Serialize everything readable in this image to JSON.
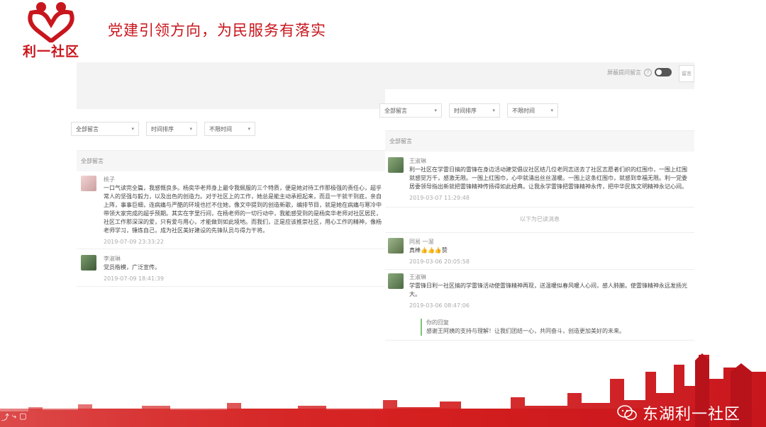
{
  "slide": {
    "logo_text": "利一社区",
    "title": "党建引领方向，为民服务有落实"
  },
  "right_top": {
    "toggle_label": "屏蔽提问留言",
    "button_label": "留言"
  },
  "left_panel": {
    "filters": [
      "全部留言",
      "时间排序",
      "不限时间"
    ],
    "section_title": "全部留言",
    "messages": [
      {
        "name": "桃子",
        "content": "一口气读完全篇，我感慨良多。杨奕华老师身上最令我佩服的三个特质，便是她对待工作那极强的责任心，超乎常人的坚强与毅力，以及出色的创造力。对于社区上的工作，她总是能主动承担起来，而且一干就干到底，亲自上阵，事事巨细，连病痛与严酷的环境也拦不住她，像文中提到的创造新歌，编排节目，就是她在病痛与寒冷中带领大家完成的超乎预期。其实在字里行间，在杨老师的一切行动中，我能感受到的是杨奕华老师对社区居民，社区工作那深深的爱，只有爱与用心，才能做到如此境地。而我们，正是应该推崇社区，用心工作的精神，像杨老师学习，锤炼自己，成为社区美好建设的先锋队员与得力干将。",
        "time": "2019-07-09 23:33:22"
      },
      {
        "name": "李淑琳",
        "content": "党员楷模，广泛宣传。",
        "time": "2019-07-09 18:41:39"
      }
    ]
  },
  "right_panel": {
    "filters": [
      "全部留言",
      "时间排序",
      "不限时间"
    ],
    "section_title": "全部留言",
    "messages": [
      {
        "name": "王淑琳",
        "content": "利一社区在学雷日搞的雷锋在身边活动建党倡议社区结几位老同志送去了社区志愿者们织的红围巾，一围上红围就感觉万千，感激无限。一围上红围巾，心中就涌出丝丝温暖。一围上这条红围巾，就感到幸福无限。利一党委居委领导指出新就把雷锋精神传扬得如此经典。让我永学雷锋把雷锋精神永传，把中华民族文明精神永记心间。",
        "time": "2019-03-07 11:29:48"
      },
      {
        "name": "同易 一溜",
        "content": "真棒👍👍👍赞",
        "time": "2019-03-06 20:05:58"
      },
      {
        "name": "王淑琳",
        "content": "学雷锋日利一社区搞的学雷锋活动使雷锋精神再现，送温暖似春风暖人心间，感人肺腑。使雷锋精神永远发扬光大。",
        "time": "2019-03-06 08:47:06"
      }
    ],
    "read_divider": "以下为已读消息",
    "reply": {
      "label": "你的回复",
      "text": "感谢王阿姨的支持与理解！让我们团结一心，共同奋斗，创造更加美好的未来。"
    }
  },
  "footer": {
    "brand": "东湖利一社区"
  },
  "colors": {
    "brand_red": "#c8161d",
    "footer_red": "#d41d1d"
  }
}
